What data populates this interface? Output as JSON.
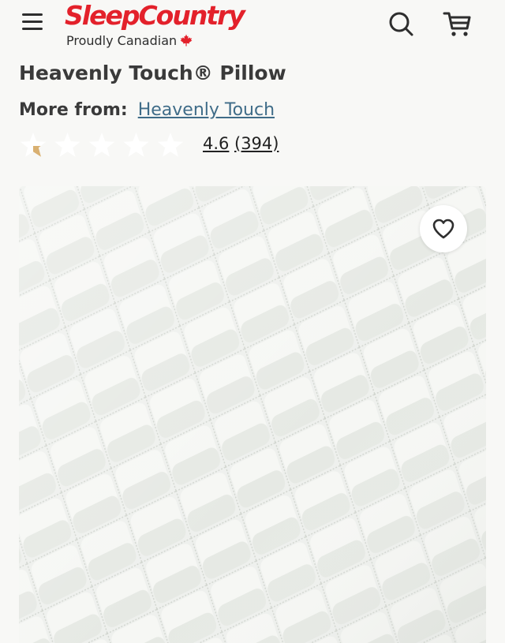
{
  "header": {
    "logo_text": "SleepCountry",
    "logo_tagline": "Proudly Canadian",
    "menu_icon": "hamburger-menu-icon",
    "search_icon": "search-icon",
    "cart_icon": "shopping-cart-icon",
    "brand_color": "#e3212b"
  },
  "product": {
    "title": "Heavenly Touch® Pillow",
    "more_from_label": "More from:",
    "brand_link": "Heavenly Touch",
    "rating": 4.6,
    "rating_text": "4.6",
    "review_count_text": "(394)",
    "stars_max": 5,
    "star_color": "#d9b071",
    "wishlist_icon": "heart-icon"
  }
}
